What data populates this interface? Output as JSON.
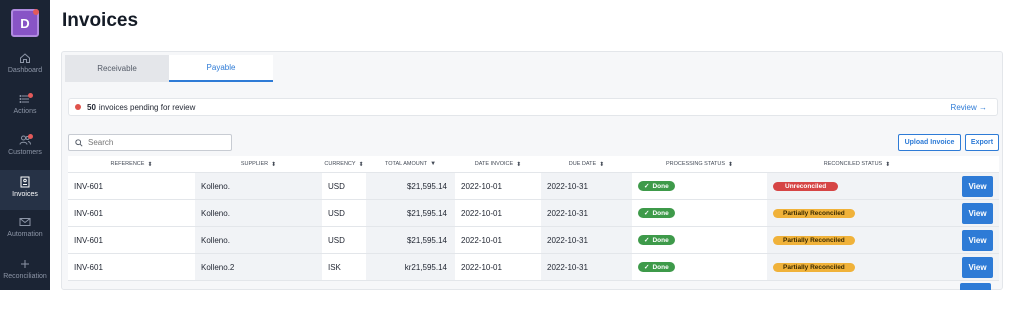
{
  "sidebar": {
    "logo_letter": "D",
    "items": [
      {
        "label": "Dashboard",
        "icon": "home-icon"
      },
      {
        "label": "Actions",
        "icon": "list-icon"
      },
      {
        "label": "Customers",
        "icon": "users-icon"
      },
      {
        "label": "Invoices",
        "icon": "invoice-icon"
      },
      {
        "label": "Automation",
        "icon": "mail-icon"
      },
      {
        "label": "Reconciliation",
        "icon": "plus-icon"
      }
    ]
  },
  "page": {
    "title": "Invoices"
  },
  "tabs": {
    "receivable": "Receivable",
    "payable": "Payable",
    "active": "Payable"
  },
  "banner": {
    "count": "50",
    "text": "invoices pending for review",
    "link": "Review →"
  },
  "search": {
    "placeholder": "Search"
  },
  "toolbar": {
    "upload_label": "Upload Invoice",
    "export_label": "Export"
  },
  "table": {
    "headers": {
      "reference": "REFERENCE",
      "supplier": "SUPPLIER",
      "currency": "CURRENCY",
      "total_amount": "TOTAL AMOUNT",
      "date_invoice": "DATE INVOICE",
      "due_date": "DUE DATE",
      "processing_status": "PROCESSING STATUS",
      "reconciled_status": "RECONCILED STATUS"
    },
    "rows": [
      {
        "reference": "INV-601",
        "supplier": "Kolleno.",
        "currency": "USD",
        "amount": "$21,595.14",
        "date_invoice": "2022-10-01",
        "due_date": "2022-10-31",
        "processing": "Done",
        "reconciled": "Unreconciled",
        "action": "View"
      },
      {
        "reference": "INV-601",
        "supplier": "Kolleno.",
        "currency": "USD",
        "amount": "$21,595.14",
        "date_invoice": "2022-10-01",
        "due_date": "2022-10-31",
        "processing": "Done",
        "reconciled": "Partially Reconciled",
        "action": "View"
      },
      {
        "reference": "INV-601",
        "supplier": "Kolleno.",
        "currency": "USD",
        "amount": "$21,595.14",
        "date_invoice": "2022-10-01",
        "due_date": "2022-10-31",
        "processing": "Done",
        "reconciled": "Partially Reconciled",
        "action": "View"
      },
      {
        "reference": "INV-601",
        "supplier": "Kolleno.2",
        "currency": "ISK",
        "amount": "kr21,595.14",
        "date_invoice": "2022-10-01",
        "due_date": "2022-10-31",
        "processing": "Done",
        "reconciled": "Partially Reconciled",
        "action": "View"
      }
    ]
  },
  "colors": {
    "sidebar_bg": "#1b2434",
    "accent": "#2e7bd6",
    "done": "#3e9a4a",
    "unreconciled": "#d64545",
    "partial": "#f0b23a",
    "alert_dot": "#e0534b",
    "logo": "#8854c6"
  }
}
